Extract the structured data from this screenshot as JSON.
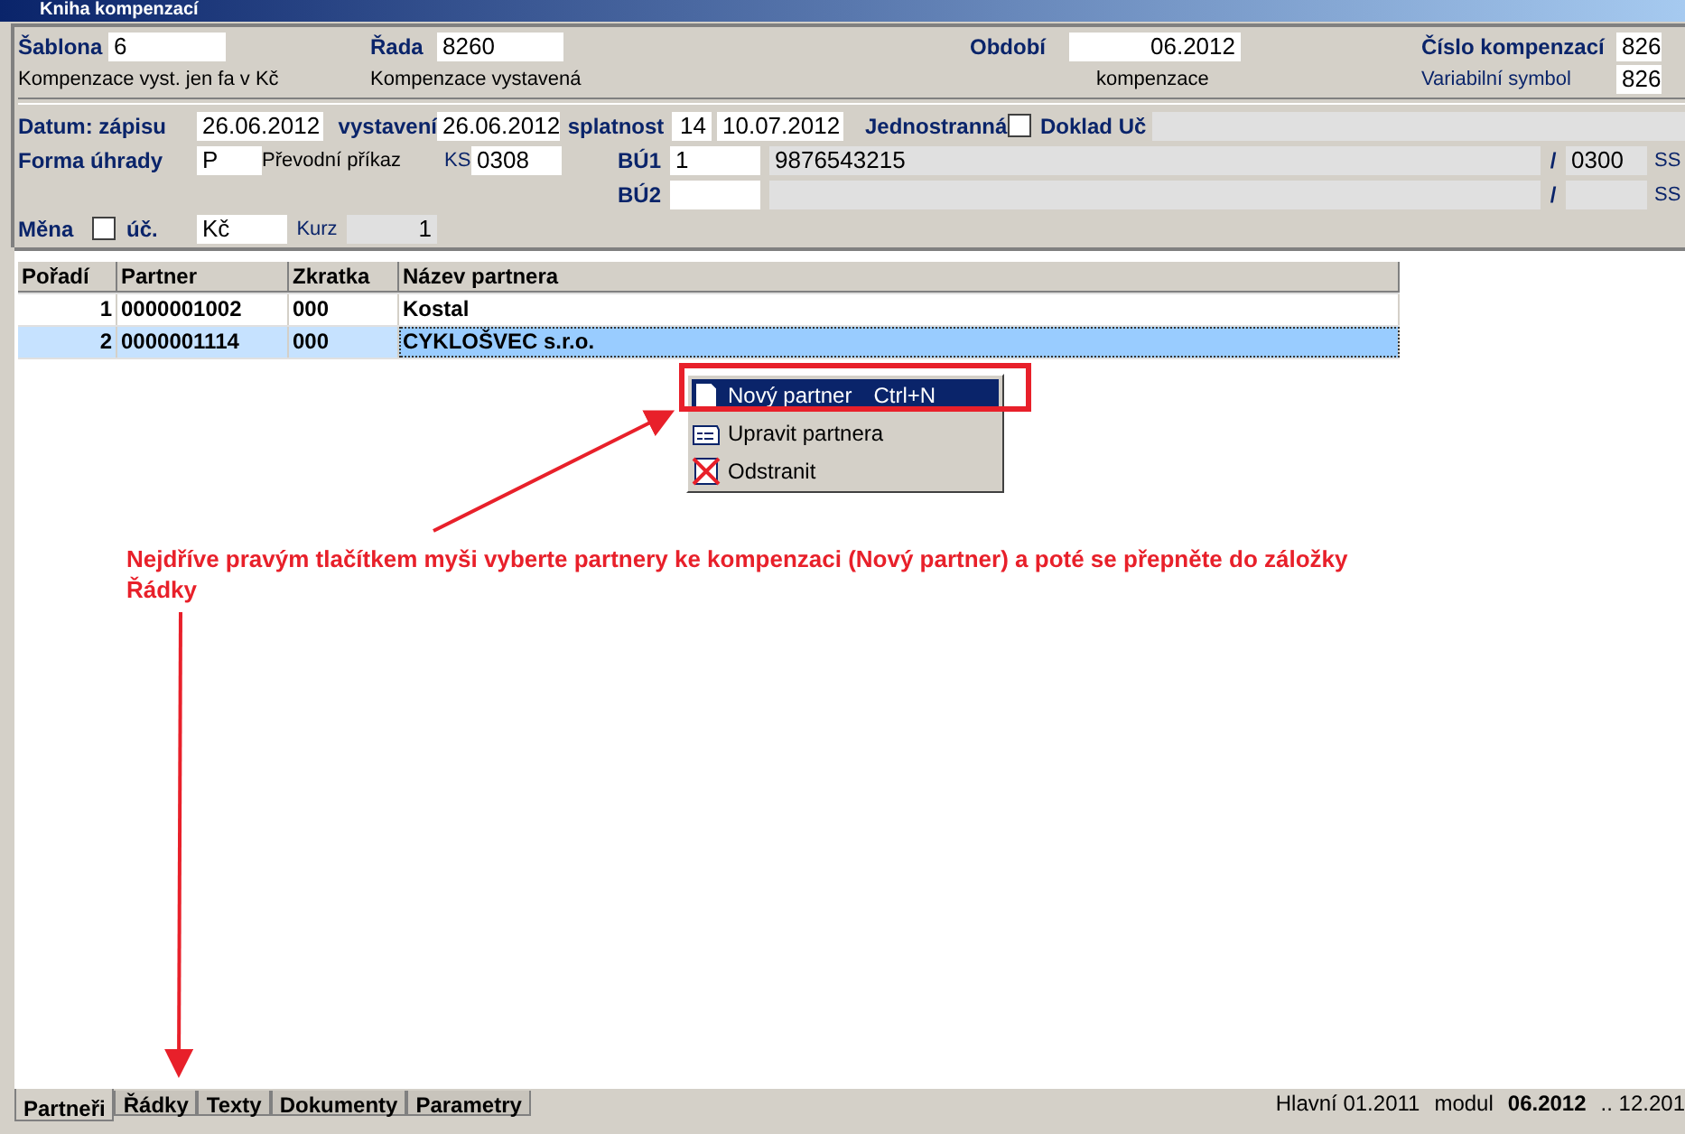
{
  "window": {
    "title": "Kniha kompenzací"
  },
  "header": {
    "sablona": {
      "label": "Šablona",
      "value": "6",
      "description": "Kompenzace vyst. jen fa v Kč"
    },
    "rada": {
      "label": "Řada",
      "value": "8260",
      "description": "Kompenzace vystavená"
    },
    "obdobi": {
      "label": "Období",
      "value": "06.2012",
      "description": "kompenzace"
    },
    "cislo": {
      "label": "Číslo kompenzací",
      "value": "826"
    },
    "variabilni": {
      "label": "Variabilní symbol",
      "value": "826"
    }
  },
  "dates": {
    "label": "Datum: zápisu",
    "zapis": "26.06.2012",
    "vystaveni_label": "vystavení",
    "vystaveni": "26.06.2012",
    "splatnost_label": "splatnost",
    "days": "14",
    "splatnost": "10.07.2012",
    "jednostranna_label": "Jednostranná",
    "jednostranna": false,
    "doklad_label": "Doklad Uč"
  },
  "payment": {
    "label": "Forma úhrady",
    "code": "P",
    "name": "Převodní příkaz",
    "ks_label": "KS",
    "ks": "0308"
  },
  "accounts": [
    {
      "label": "BÚ1",
      "number": "1",
      "account": "9876543215",
      "separator": "/",
      "bank": "0300",
      "ss_label": "SS"
    },
    {
      "label": "BÚ2",
      "separator": "/",
      "ss_label": "SS"
    }
  ],
  "currency": {
    "label": "Měna",
    "checked": false,
    "uc_label": "úč.",
    "value": "Kč",
    "kurz_label": "Kurz",
    "kurz": "1"
  },
  "table": {
    "columns": [
      "Pořadí",
      "Partner",
      "Zkratka",
      "Název partnera"
    ],
    "rows": [
      {
        "cells": [
          "1",
          "0000001002",
          "000",
          "Kostal"
        ],
        "selected": false
      },
      {
        "cells": [
          "2",
          "0000001114",
          "000",
          "CYKLOŠVEC s.r.o."
        ],
        "selected": true
      }
    ]
  },
  "context_menu": [
    {
      "kind": "new",
      "label": "Nový partner",
      "shortcut": "Ctrl+N",
      "selected": true
    },
    {
      "kind": "edit",
      "label": "Upravit partnera",
      "selected": false
    },
    {
      "kind": "delete",
      "label": "Odstranit",
      "selected": false
    }
  ],
  "annotation": "Nejdříve pravým tlačítkem myši vyberte partnery ke kompenzaci (Nový partner) a poté se přepněte do záložky Řádky",
  "tabs": [
    {
      "label": "Partneři",
      "selected": true
    },
    {
      "label": "Řádky",
      "selected": false
    },
    {
      "label": "Texty",
      "selected": false
    },
    {
      "label": "Dokumenty",
      "selected": false
    },
    {
      "label": "Parametry",
      "selected": false
    }
  ],
  "status": {
    "main": "Hlavní 01.2011",
    "module_label": "modul",
    "module": "06.2012",
    "range": ".. 12.201"
  }
}
